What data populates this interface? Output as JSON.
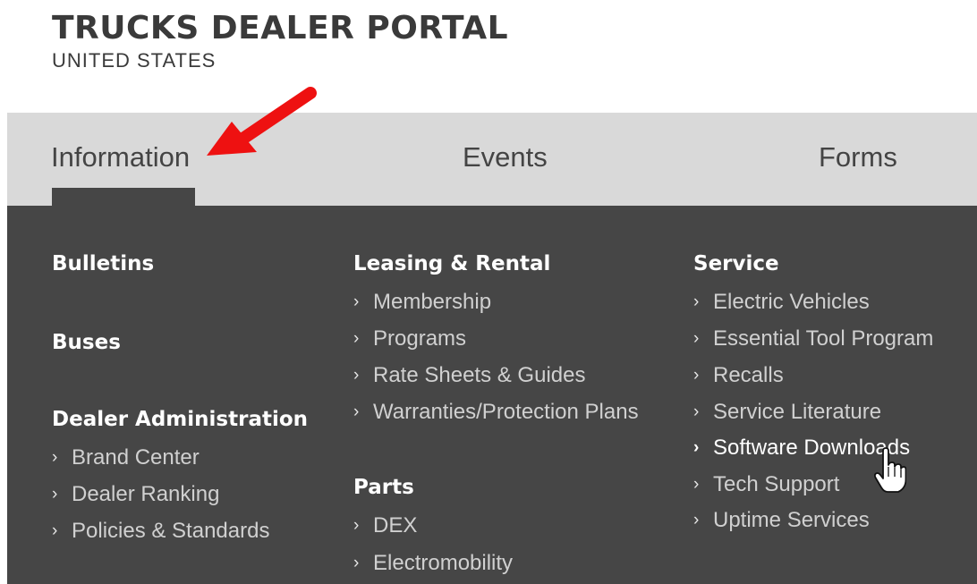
{
  "header": {
    "title": "TRUCKS DEALER PORTAL",
    "subtitle": "UNITED STATES"
  },
  "nav": {
    "tabs": [
      "Information",
      "Events",
      "Forms"
    ],
    "active_tab": "Information"
  },
  "menu": {
    "col1": {
      "bulletins": "Bulletins",
      "buses": "Buses",
      "dealer_admin": {
        "heading": "Dealer Administration",
        "links": [
          "Brand Center",
          "Dealer Ranking",
          "Policies & Standards"
        ]
      }
    },
    "col2": {
      "leasing": {
        "heading": "Leasing & Rental",
        "links": [
          "Membership",
          "Programs",
          "Rate Sheets & Guides",
          "Warranties/Protection Plans"
        ]
      },
      "parts": {
        "heading": "Parts",
        "links": [
          "DEX",
          "Electromobility"
        ]
      }
    },
    "col3": {
      "service": {
        "heading": "Service",
        "links": [
          "Electric Vehicles",
          "Essential Tool Program",
          "Recalls",
          "Service Literature",
          "Software Downloads",
          "Tech Support",
          "Uptime Services"
        ]
      }
    },
    "hovered_link": "Software Downloads"
  },
  "icons": {
    "link_chevron": "chevron-right-icon",
    "annotation": "red-arrow-icon",
    "cursor": "hand-pointer-icon"
  },
  "colors": {
    "panel_bg": "#464646",
    "nav_bg": "#d9d9d9",
    "annotation": "#ee1111"
  }
}
